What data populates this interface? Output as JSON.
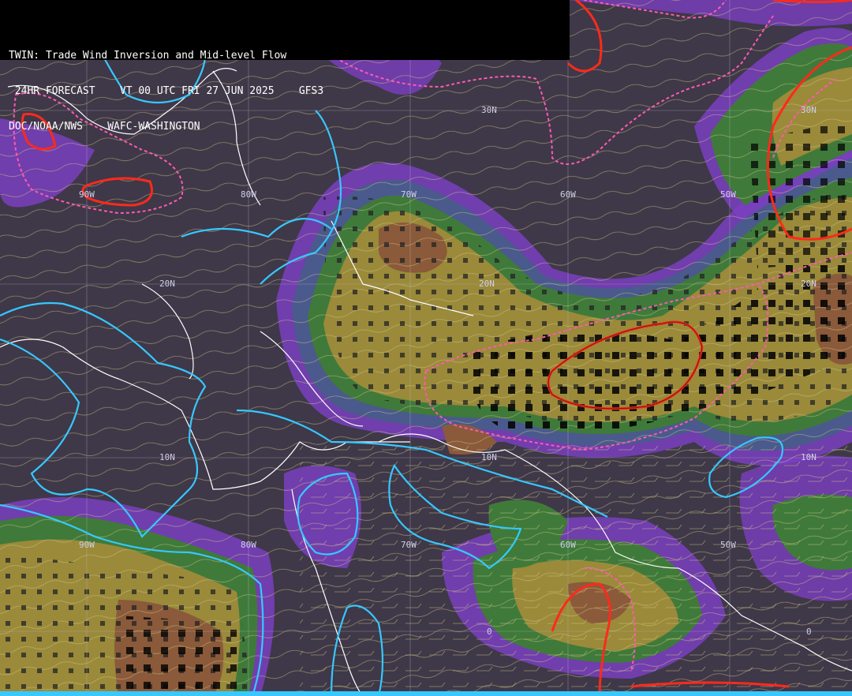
{
  "header": {
    "line1": "TWIN: Trade Wind Inversion and Mid-level Flow",
    "line2": " 24HR FORECAST    VT 00 UTC FRI 27 JUN 2025    GFS3",
    "line3": "DOC/NOAA/NWS    WAFC-WASHINGTON"
  },
  "grid_labels": {
    "lat_30n": "30N",
    "lat_20n_west": "20N",
    "lat_20n_mid": "20N",
    "lat_20n_east": "20N",
    "lat_30n_east": "30N",
    "lat_10n_west": "10N",
    "lat_10n_mid": "10N",
    "lat_10n_east": "10N",
    "lon_90w_top": "90W",
    "lon_80w_top": "80W",
    "lon_70w_top": "70W",
    "lon_60w_top": "60W",
    "lon_50w_top": "50W",
    "lon_90w_bottom": "90W",
    "lon_80w_bottom": "80W",
    "lon_70w_bottom": "70W",
    "lon_60w_bottom": "60W",
    "lon_50w_bottom": "50W",
    "eq_mid": "0",
    "eq_east": "0"
  },
  "colors": {
    "background": "#3f3848",
    "purple": "#7a3fc0",
    "blue_gray": "#4a5a8c",
    "green": "#3f7a3a",
    "ochre": "#9a8a3a",
    "brown": "#8a5a3a",
    "red_contour": "#ff2a1a",
    "pink_dashed": "#ff5ab0",
    "cyan_contour": "#36c8ff",
    "coastline": "#ffffff",
    "streamline": "#d8cc8a",
    "grid": "#b8b8c8"
  }
}
